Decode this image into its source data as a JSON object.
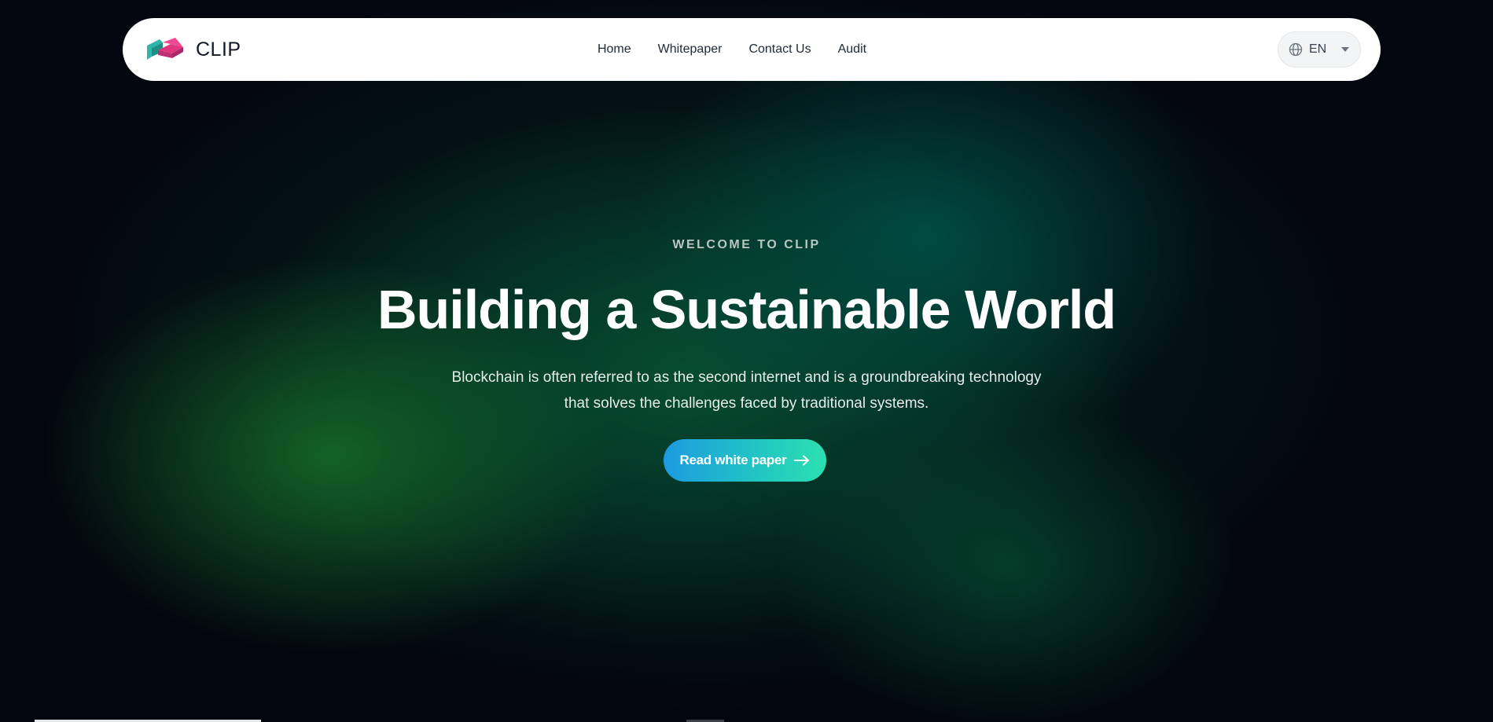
{
  "brand": {
    "name": "CLIP",
    "logo_icon": "clip-chain-logo-icon"
  },
  "nav": {
    "items": [
      {
        "label": "Home"
      },
      {
        "label": "Whitepaper"
      },
      {
        "label": "Contact Us"
      },
      {
        "label": "Audit"
      }
    ]
  },
  "language": {
    "icon": "globe-icon",
    "value": "EN",
    "dropdown_icon": "caret-down-icon"
  },
  "hero": {
    "eyebrow": "WELCOME TO CLIP",
    "title": "Building a Sustainable World",
    "subtitle_line1": "Blockchain is often referred to as the second internet and is a groundbreaking technology",
    "subtitle_line2": "that solves the challenges faced by traditional systems.",
    "cta_label": "Read white paper",
    "cta_icon": "arrow-right-icon"
  },
  "colors": {
    "background": "#03060f",
    "glow_green": "#166e28",
    "glow_teal": "#005046",
    "cta_start": "#1c9be0",
    "cta_end": "#2be0b0",
    "navbar": "#ffffff"
  }
}
